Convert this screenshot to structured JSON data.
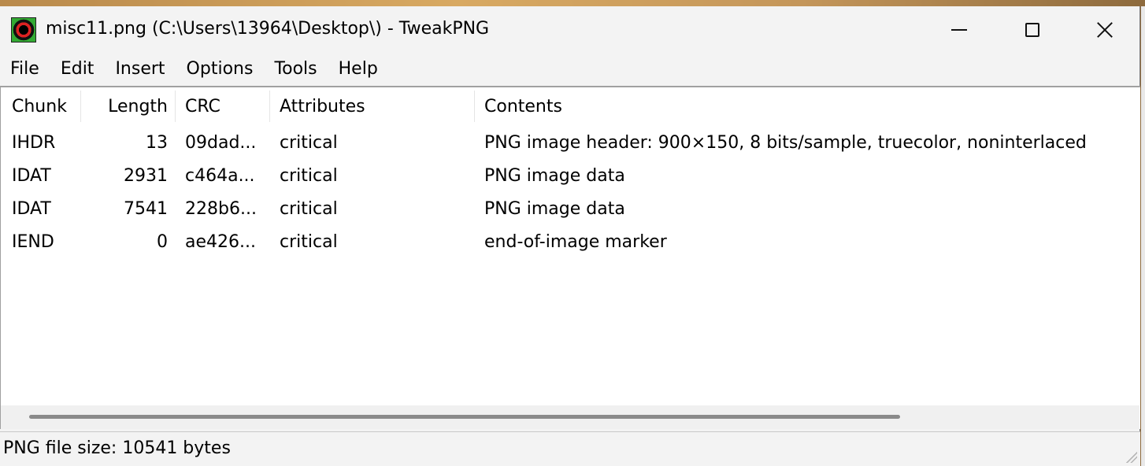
{
  "window": {
    "title": "misc11.png (C:\\Users\\13964\\Desktop\\) - TweakPNG"
  },
  "menu": [
    "File",
    "Edit",
    "Insert",
    "Options",
    "Tools",
    "Help"
  ],
  "columns": [
    "Chunk",
    "Length",
    "CRC",
    "Attributes",
    "Contents"
  ],
  "rows": [
    {
      "chunk": "IHDR",
      "length": "13",
      "crc": "09dad...",
      "attributes": "critical",
      "contents": "PNG image header: 900×150, 8 bits/sample, truecolor, noninterlaced"
    },
    {
      "chunk": "IDAT",
      "length": "2931",
      "crc": "c464a...",
      "attributes": "critical",
      "contents": "PNG image data"
    },
    {
      "chunk": "IDAT",
      "length": "7541",
      "crc": "228b6...",
      "attributes": "critical",
      "contents": "PNG image data"
    },
    {
      "chunk": "IEND",
      "length": "0",
      "crc": "ae426...",
      "attributes": "critical",
      "contents": "end-of-image marker"
    }
  ],
  "status": {
    "text": "PNG file size: 10541 bytes"
  },
  "icons": {
    "app": "tweakpng-app-icon",
    "minimize": "minimize-icon",
    "maximize": "maximize-icon",
    "close": "close-icon"
  },
  "colors": {
    "window_bg": "#f3f3f3",
    "list_bg": "#ffffff"
  }
}
